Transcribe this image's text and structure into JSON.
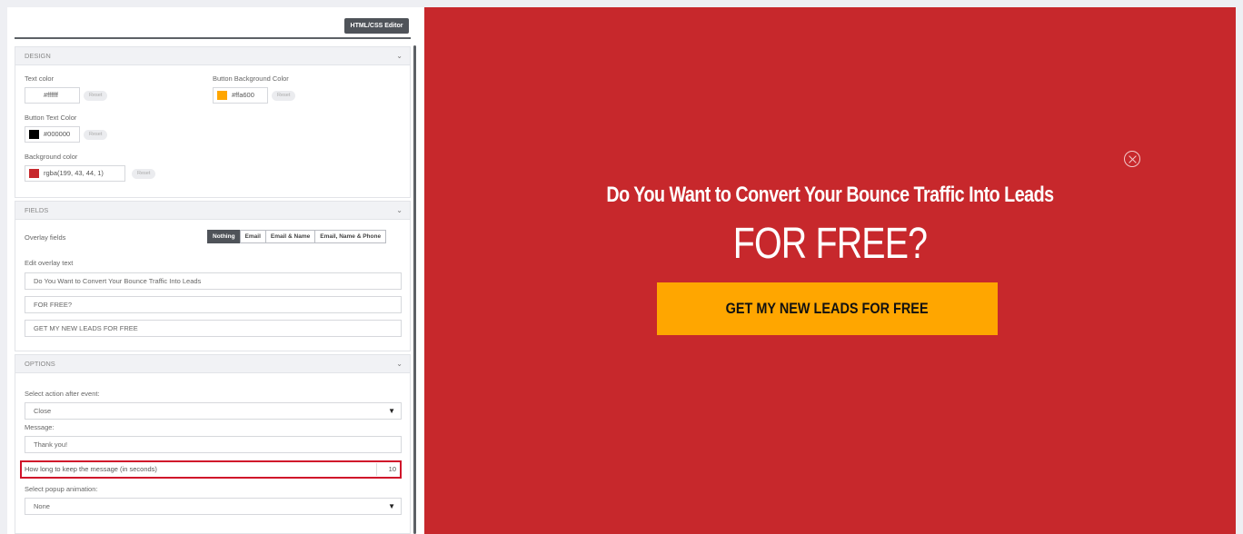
{
  "toolbar": {
    "editor_label": "HTML/CSS Editor"
  },
  "design": {
    "title": "DESIGN",
    "text_color_label": "Text color",
    "text_color_value": "#ffffff",
    "button_bg_label": "Button Background Color",
    "button_bg_value": "#ffa600",
    "button_text_label": "Button Text Color",
    "button_text_value": "#000000",
    "bg_color_label": "Background color",
    "bg_color_value": "rgba(199, 43, 44, 1)",
    "reset_label": "Reset"
  },
  "fields": {
    "title": "FIELDS",
    "overlay_fields_label": "Overlay fields",
    "options": [
      "Nothing",
      "Email",
      "Email & Name",
      "Email, Name & Phone"
    ],
    "selected": "Nothing",
    "edit_overlay_label": "Edit overlay text",
    "line1": "Do You Want to Convert Your Bounce Traffic Into Leads",
    "line2": "FOR FREE?",
    "line3": "GET MY NEW LEADS FOR FREE"
  },
  "options": {
    "title": "OPTIONS",
    "action_label": "Select action after event:",
    "action_value": "Close",
    "message_label": "Message:",
    "message_value": "Thank you!",
    "duration_label": "How long to keep the message (in seconds)",
    "duration_value": "10",
    "animation_label": "Select popup animation:",
    "animation_value": "None"
  },
  "preview": {
    "headline": "Do You Want to Convert Your Bounce Traffic Into Leads",
    "subhead": "FOR FREE?",
    "cta": "GET MY NEW LEADS FOR FREE"
  },
  "colors": {
    "background": "#c7282c",
    "button_bg": "#ffa600",
    "button_text": "#000000",
    "text": "#ffffff"
  },
  "icons": {
    "close": "close-circle-icon",
    "collapse": "chevron-down-icon",
    "select": "caret-down-icon"
  }
}
